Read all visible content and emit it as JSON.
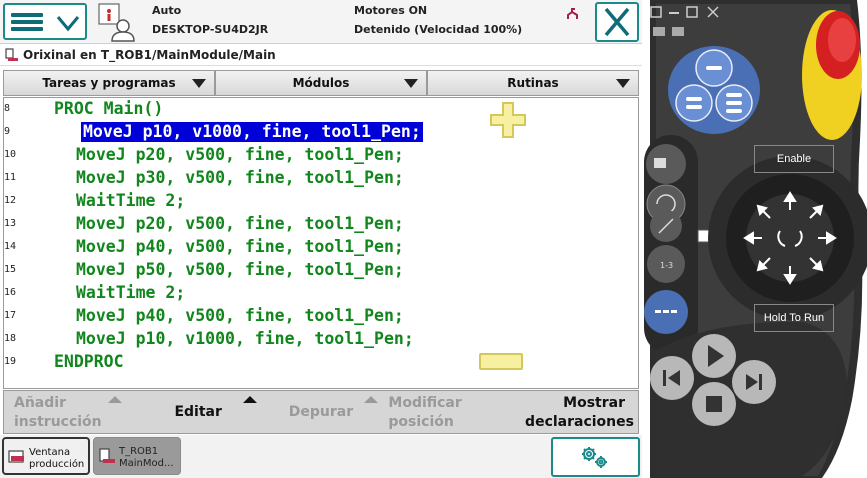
{
  "header": {
    "operating_mode": "Auto",
    "controller_name": "DESKTOP-SU4D2JR",
    "motors_status": "Motores ON",
    "execution_status": "Detenido (Velocidad 100%)"
  },
  "path": {
    "text": "Orixinal en T_ROB1/MainModule/Main"
  },
  "tabs": [
    {
      "label": "Tareas y programas"
    },
    {
      "label": "Módulos"
    },
    {
      "label": "Rutinas"
    }
  ],
  "code": {
    "lines": [
      {
        "num": "8",
        "text": "PROC Main()",
        "indent": 1,
        "selected": false
      },
      {
        "num": "9",
        "text": "MoveJ p10, v1000, fine, tool1_Pen;",
        "indent": 2,
        "selected": true
      },
      {
        "num": "10",
        "text": "MoveJ p20, v500, fine, tool1_Pen;",
        "indent": 2,
        "selected": false
      },
      {
        "num": "11",
        "text": "MoveJ p30, v500, fine, tool1_Pen;",
        "indent": 2,
        "selected": false
      },
      {
        "num": "12",
        "text": "WaitTime 2;",
        "indent": 2,
        "selected": false
      },
      {
        "num": "13",
        "text": "MoveJ p20, v500, fine, tool1_Pen;",
        "indent": 2,
        "selected": false
      },
      {
        "num": "14",
        "text": "MoveJ p40, v500, fine, tool1_Pen;",
        "indent": 2,
        "selected": false
      },
      {
        "num": "15",
        "text": "MoveJ p50, v500, fine, tool1_Pen;",
        "indent": 2,
        "selected": false
      },
      {
        "num": "16",
        "text": "WaitTime 2;",
        "indent": 2,
        "selected": false
      },
      {
        "num": "17",
        "text": "MoveJ p40, v500, fine, tool1_Pen;",
        "indent": 2,
        "selected": false
      },
      {
        "num": "18",
        "text": "MoveJ p10, v1000, fine, tool1_Pen;",
        "indent": 2,
        "selected": false
      },
      {
        "num": "19",
        "text": "ENDPROC",
        "indent": 1,
        "selected": false
      }
    ]
  },
  "bottom_menu": {
    "add_instruction": [
      "Añadir",
      "instrucción"
    ],
    "edit": "Editar",
    "debug": "Depurar",
    "modify_position": [
      "Modificar",
      "posición"
    ],
    "show_declarations": [
      "Mostrar",
      "declaraciones"
    ]
  },
  "taskbar": {
    "production_window": [
      "Ventana",
      "producción"
    ],
    "program_editor": [
      "T_ROB1",
      "MainMod..."
    ]
  },
  "pendant": {
    "enable_label": "Enable",
    "hold_to_run_label": "Hold To Run"
  },
  "colors": {
    "accent": "#1a8a8a",
    "code_text": "#11861c",
    "selection": "#0000d8",
    "pendant_body": "#3d3d3d",
    "pendant_blue": "#4a6fb5",
    "emergency_stop": "#d42020",
    "emergency_ring": "#f0d020"
  }
}
